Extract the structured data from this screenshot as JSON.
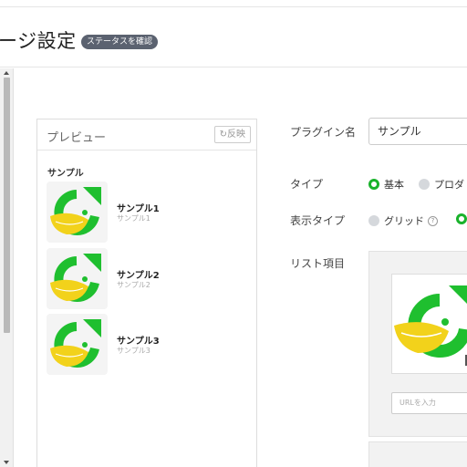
{
  "header": {
    "title": "ージ設定",
    "status_badge": "ステータスを確認"
  },
  "preview": {
    "title": "プレビュー",
    "reflect_label": "反映",
    "section_label": "サンプル",
    "items": [
      {
        "title": "サンプル1",
        "subtitle": "サンプル1"
      },
      {
        "title": "サンプル2",
        "subtitle": "サンプル2"
      },
      {
        "title": "サンプル3",
        "subtitle": "サンプル3"
      }
    ]
  },
  "form": {
    "plugin_name_label": "プラグイン名",
    "plugin_name_value": "サンプル",
    "type_label": "タイプ",
    "type_options": [
      {
        "label": "基本",
        "selected": true
      },
      {
        "label": "プロダ",
        "selected": false
      }
    ],
    "display_type_label": "表示タイプ",
    "display_type_options": [
      {
        "label": "グリッド",
        "selected": false
      },
      {
        "label": "",
        "selected": true
      }
    ],
    "help_glyph": "?",
    "list_label": "リスト項目",
    "url_placeholder": "URLを入力"
  },
  "colors": {
    "accent": "#19b22b",
    "badge": "#5b6270",
    "logo_green": "#1fbf2f",
    "logo_yellow": "#f2d21b"
  },
  "icons": {
    "reflect": "refresh-icon",
    "help": "question-circle-icon",
    "scroll_up": "triangle-up-icon",
    "scroll_down": "triangle-down-icon"
  }
}
